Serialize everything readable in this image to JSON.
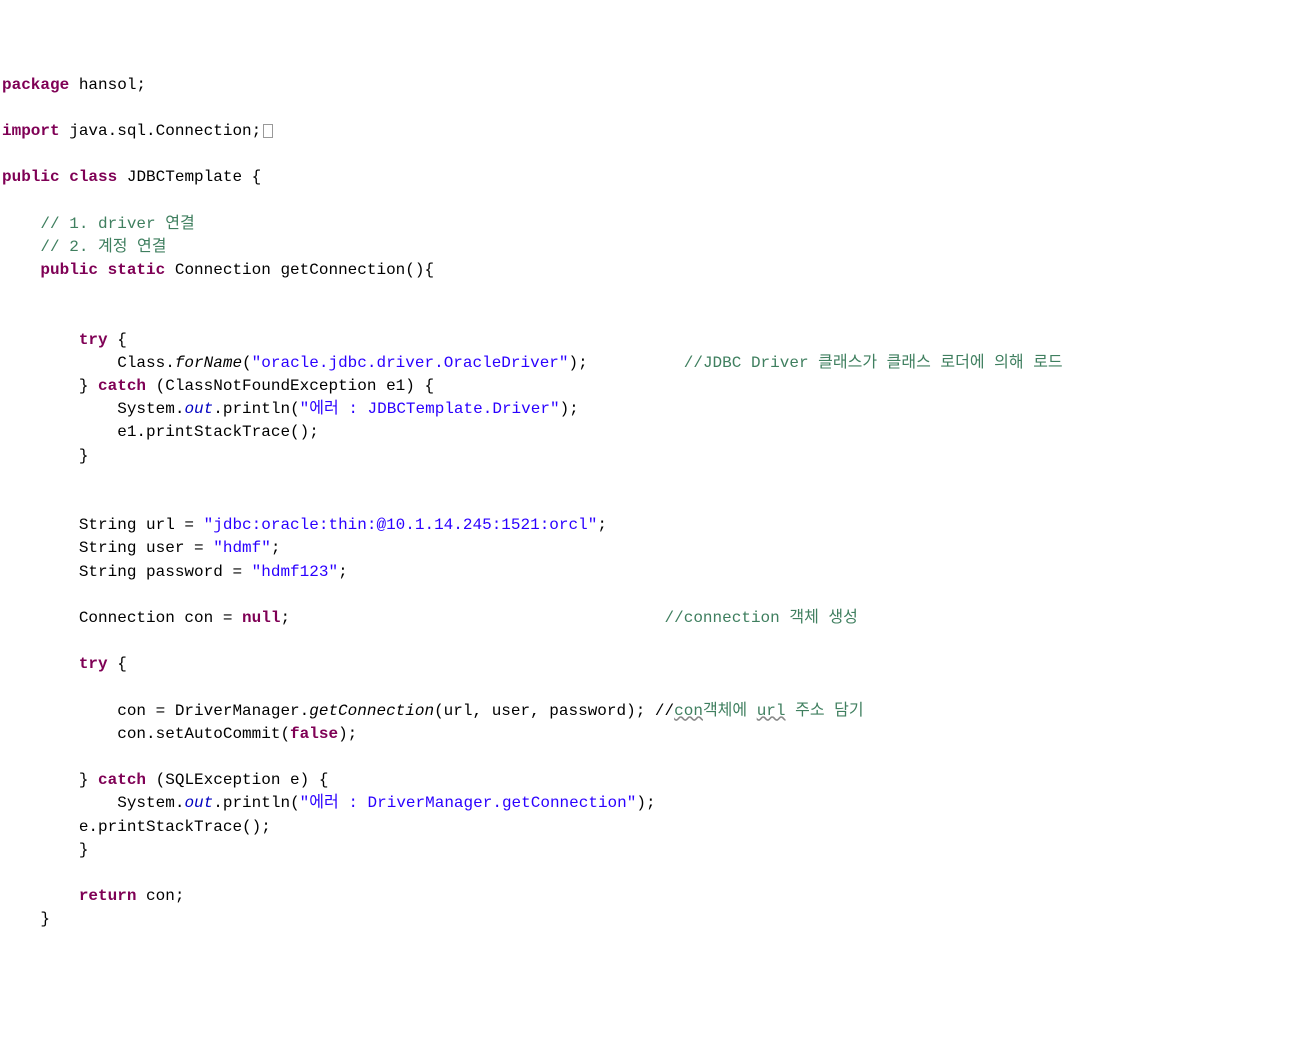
{
  "line1_kw1": "package",
  "line1_txt": " hansol;",
  "line3_kw1": "import",
  "line3_txt": " java.sql.Connection;",
  "line5_kw1": "public",
  "line5_kw2": "class",
  "line5_txt": " JDBCTemplate {",
  "line7_comment": "    // 1. driver 연결",
  "line8_comment": "    // 2. 계정 연결",
  "line9_kw1": "public",
  "line9_kw2": "static",
  "line9_txt": " Connection getConnection(){",
  "line12_kw": "try",
  "line12_txt": " {",
  "line13_pre": "            Class.",
  "line13_method": "forName",
  "line13_mid": "(",
  "line13_str": "\"oracle.jdbc.driver.OracleDriver\"",
  "line13_post": ");",
  "line13_comment": "          //JDBC Driver 클래스가 클래스 로더에 의해 로드",
  "line14_pre": "        } ",
  "line14_kw": "catch",
  "line14_txt": " (ClassNotFoundException e1) {",
  "line15_pre": "            System.",
  "line15_field": "out",
  "line15_mid": ".println(",
  "line15_str": "\"에러 : JDBCTemplate.Driver\"",
  "line15_post": ");",
  "line16_txt": "            e1.printStackTrace();",
  "line17_txt": "        }",
  "line20_pre": "        String url = ",
  "line20_str": "\"jdbc:oracle:thin:@10.1.14.245:1521:orcl\"",
  "line20_post": ";",
  "line21_pre": "        String user = ",
  "line21_str": "\"hdmf\"",
  "line21_post": ";",
  "line22_pre": "        String password = ",
  "line22_str": "\"hdmf123\"",
  "line22_post": ";",
  "line24_pre": "        Connection con = ",
  "line24_kw": "null",
  "line24_post": ";",
  "line24_comment": "                                       //connection 객체 생성",
  "line26_kw": "try",
  "line26_txt": " {",
  "line28_pre": "            con = DriverManager.",
  "line28_method": "getConnection",
  "line28_mid": "(url, user, password); //",
  "line28_u1": "con",
  "line28_mid2": "객체에 ",
  "line28_u2": "url",
  "line28_comment_end": " 주소 담기",
  "line29_pre": "            con.setAutoCommit(",
  "line29_kw": "false",
  "line29_post": ");",
  "line31_pre": "        } ",
  "line31_kw": "catch",
  "line31_txt": " (SQLException e) {",
  "line32_pre": "            System.",
  "line32_field": "out",
  "line32_mid": ".println(",
  "line32_str": "\"에러 : DriverManager.getConnection\"",
  "line32_post": ");",
  "line33_txt": "        e.printStackTrace();",
  "line34_txt": "        }",
  "line36_kw": "return",
  "line36_txt": " con;",
  "line37_txt": "    }"
}
